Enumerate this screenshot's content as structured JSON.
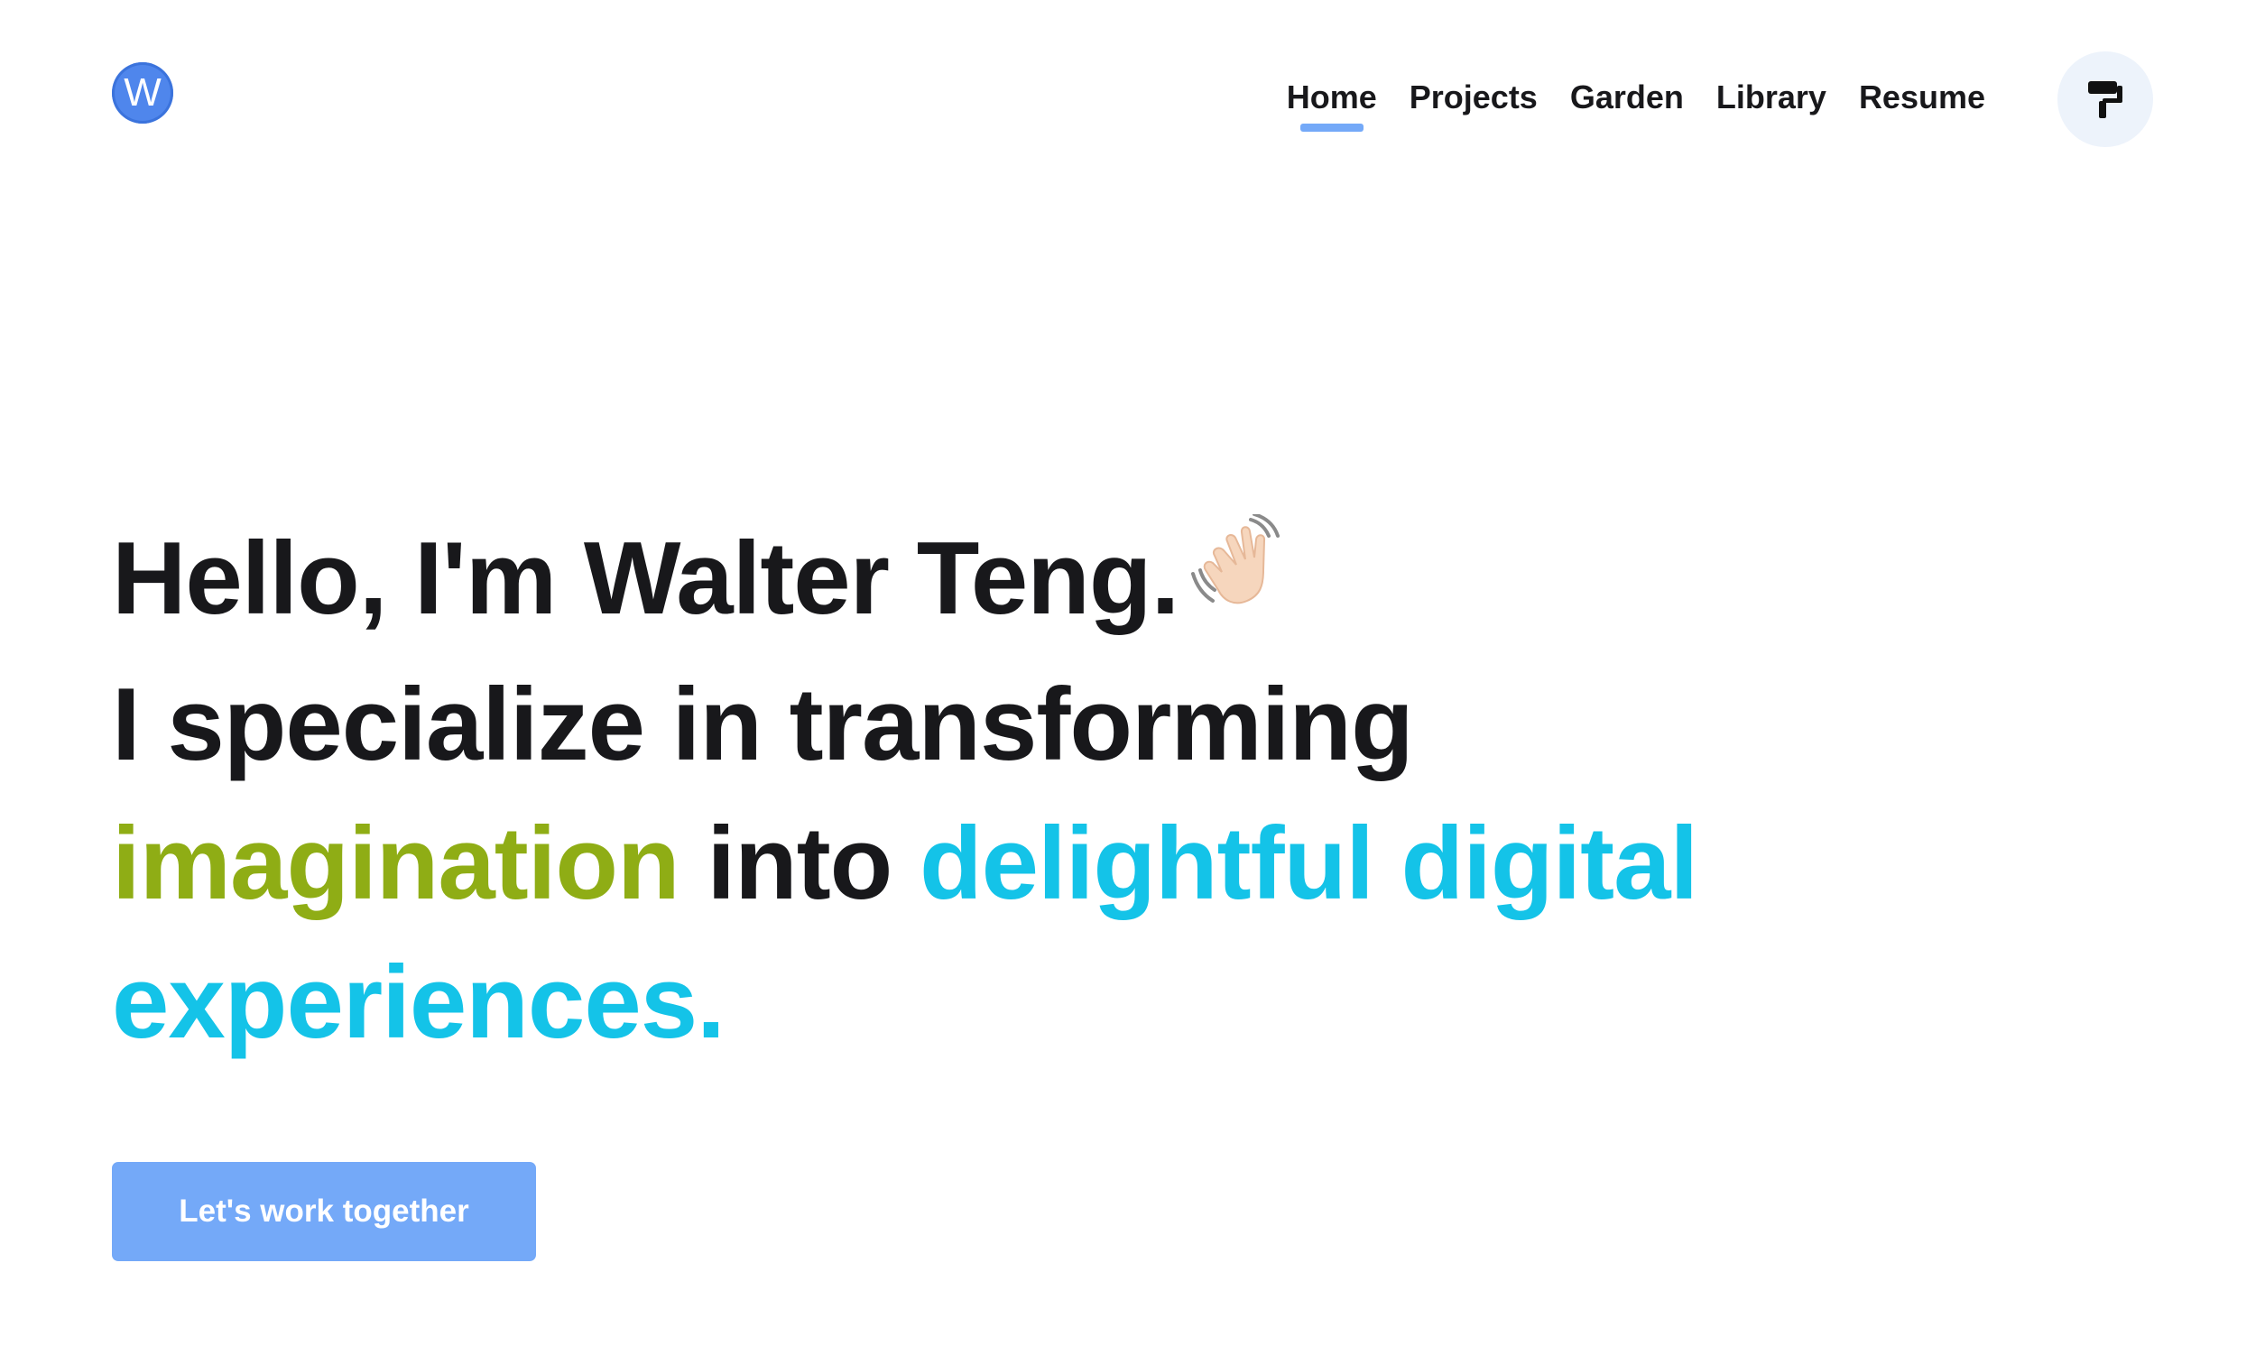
{
  "header": {
    "logo_letter": "W",
    "nav": [
      {
        "label": "Home",
        "active": true
      },
      {
        "label": "Projects",
        "active": false
      },
      {
        "label": "Garden",
        "active": false
      },
      {
        "label": "Library",
        "active": false
      },
      {
        "label": "Resume",
        "active": false
      }
    ],
    "theme_icon": "paint-roller-icon"
  },
  "hero": {
    "greeting": "Hello, I'm Walter Teng.",
    "greeting_icon": "waving-hand-icon",
    "line2": "I specialize in transforming",
    "highlight1": "imagination",
    "connector": "into",
    "highlight2a": "delightful digital",
    "highlight2b": "experiences."
  },
  "cta": {
    "label": "Let's work together"
  },
  "colors": {
    "accent_blue": "#74a9f8",
    "logo_blue": "#4f86ec",
    "green": "#8fad15",
    "cyan": "#14c3e8",
    "text": "#18181b",
    "toggle_bg": "#edf3fb"
  }
}
